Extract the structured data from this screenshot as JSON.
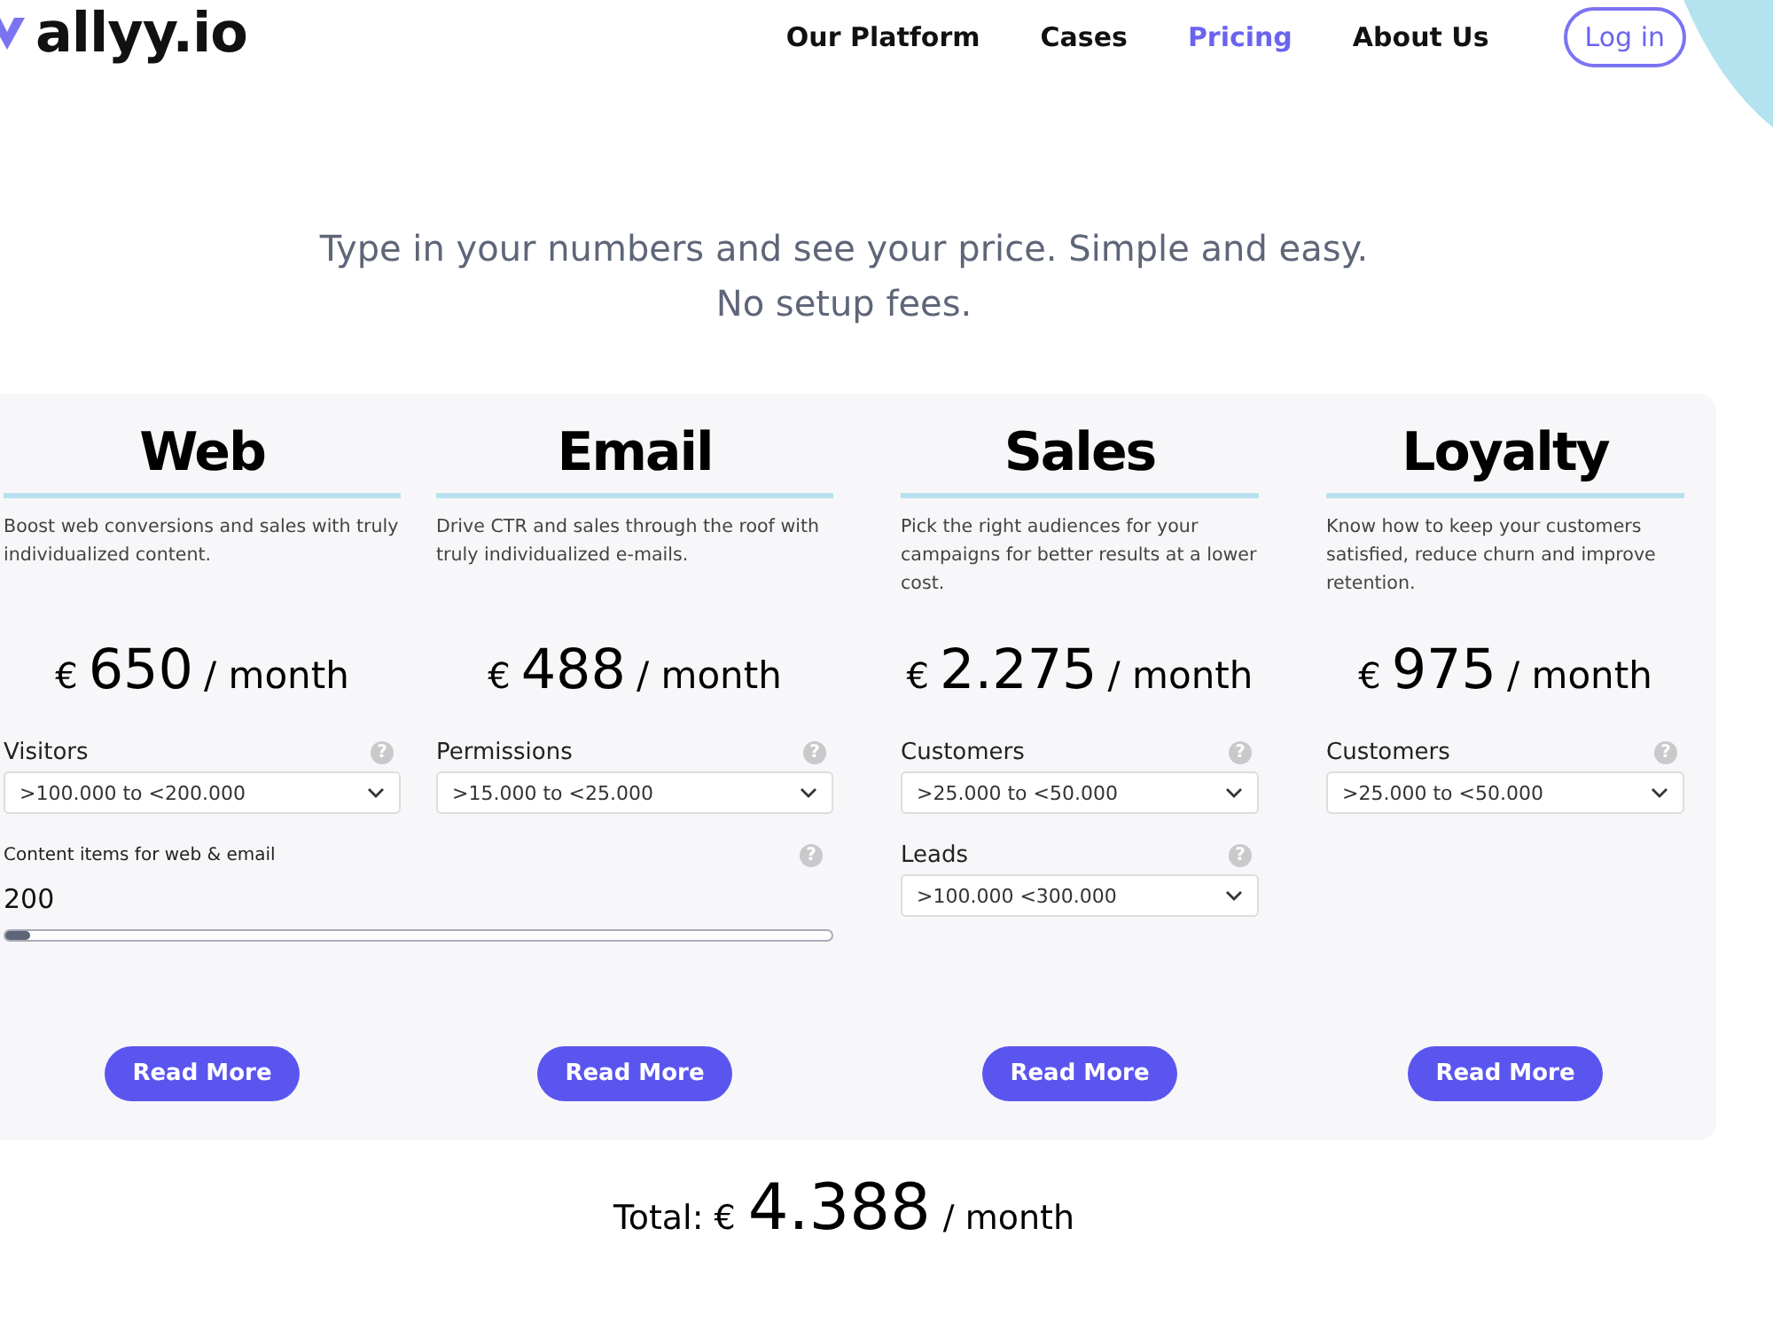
{
  "header": {
    "logo": "allyy.io",
    "nav": [
      {
        "label": "Our Platform",
        "selected": false
      },
      {
        "label": "Cases",
        "selected": false
      },
      {
        "label": "Pricing",
        "selected": true
      },
      {
        "label": "About Us",
        "selected": false
      }
    ],
    "login": "Log in"
  },
  "intro": [
    "Type in your numbers and see your price. Simple and easy.",
    "No setup fees."
  ],
  "plans": [
    {
      "title": "Web",
      "description": "Boost web conversions and sales with truly individualized content.",
      "currency": "€",
      "amount": "650",
      "period": "/ month",
      "controls": [
        {
          "kind": "select",
          "label": "Visitors",
          "help": "?",
          "value": ">100.000 to <200.000"
        },
        {
          "kind": "slider",
          "label": "Content items for web & email",
          "help": "?",
          "value": "200",
          "level": 0.03
        }
      ],
      "button": "Read More"
    },
    {
      "title": "Email",
      "description": "Drive CTR and sales through the roof with truly individualized e-mails.",
      "currency": "€",
      "amount": "488",
      "period": "/ month",
      "controls": [
        {
          "kind": "select",
          "label": "Permissions",
          "help": "?",
          "value": ">15.000 to <25.000"
        }
      ],
      "button": "Read More"
    },
    {
      "title": "Sales",
      "description": "Pick the right audiences for your campaigns for better results at a lower cost.",
      "currency": "€",
      "amount": "2.275",
      "period": "/ month",
      "controls": [
        {
          "kind": "select",
          "label": "Customers",
          "help": "?",
          "value": ">25.000 to <50.000"
        },
        {
          "kind": "select",
          "label": "Leads",
          "help": "?",
          "value": ">100.000 <300.000"
        }
      ],
      "button": "Read More"
    },
    {
      "title": "Loyalty",
      "description": "Know how to keep your customers satisfied, reduce churn and improve retention.",
      "currency": "€",
      "amount": "975",
      "period": "/ month",
      "controls": [
        {
          "kind": "select",
          "label": "Customers",
          "help": "?",
          "value": ">25.000 to <50.000"
        }
      ],
      "button": "Read More"
    }
  ],
  "total": {
    "label": "Total: €",
    "amount": "4.388",
    "period": "/ month"
  }
}
